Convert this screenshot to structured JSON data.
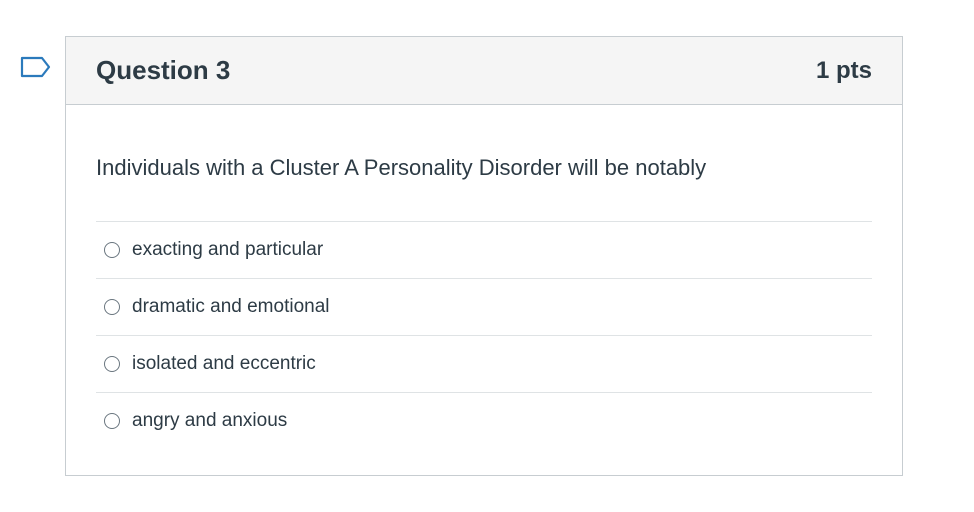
{
  "question": {
    "title": "Question 3",
    "points": "1 pts",
    "text": "Individuals with a Cluster A Personality Disorder will be notably",
    "answers": [
      {
        "label": "exacting and particular"
      },
      {
        "label": "dramatic and emotional"
      },
      {
        "label": "isolated and eccentric"
      },
      {
        "label": "angry and anxious"
      }
    ],
    "selected_index": null
  },
  "icons": {
    "flag": "flag-question-icon"
  },
  "colors": {
    "text": "#2d3b45",
    "header_bg": "#f5f5f5",
    "border": "#c7cdd1",
    "flag_stroke": "#2b7abc"
  }
}
